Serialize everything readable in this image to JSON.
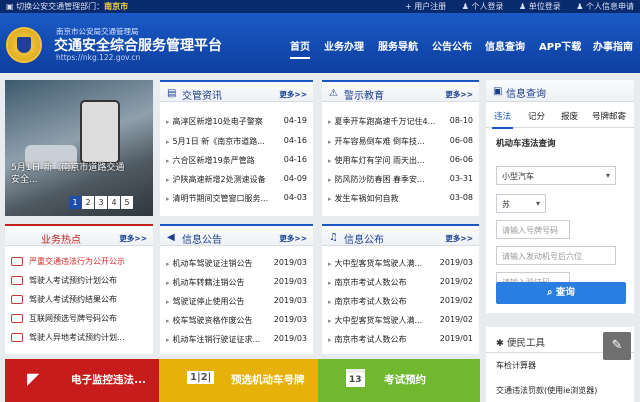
{
  "topbar": {
    "switch_label": "切换公安交通管理部门：",
    "city": "南京市",
    "links": [
      "用户注册",
      "个人登录",
      "单位登录",
      "个人信息申请"
    ]
  },
  "header": {
    "dept": "南京市公安局交通管理局",
    "title": "交通安全综合服务管理平台",
    "url": "https://nkg.122.gov.cn"
  },
  "nav": [
    "首页",
    "业务办理",
    "服务导航",
    "公告公布",
    "信息查询",
    "APP下载",
    "办事指南"
  ],
  "slider": {
    "caption": "5月1日 新《南京市道路交通安全...",
    "pages": [
      "1",
      "2",
      "3",
      "4",
      "5"
    ]
  },
  "news": {
    "title": "交管资讯",
    "more": "更多>>",
    "items": [
      {
        "title": "高淳区新增10处电子警察",
        "date": "04-19"
      },
      {
        "title": "5月1日 新《南京市道路...",
        "date": "04-16"
      },
      {
        "title": "六合区新增19条严管路",
        "date": "04-16"
      },
      {
        "title": "沪陕高速新增2处测速设备",
        "date": "04-09"
      },
      {
        "title": "清明节期间交管窗口服务...",
        "date": "04-03"
      }
    ]
  },
  "warning": {
    "title": "警示教育",
    "more": "更多>>",
    "items": [
      {
        "title": "夏季开车跑高速千万记住4...",
        "date": "08-10"
      },
      {
        "title": "开车容易倒车难 倒车技...",
        "date": "06-08"
      },
      {
        "title": "使用车灯有学问 雨天出...",
        "date": "06-06"
      },
      {
        "title": "防风防沙防春困 春季安...",
        "date": "03-31"
      },
      {
        "title": "发生车祸如何自救",
        "date": "03-08"
      }
    ]
  },
  "hot": {
    "title": "业务热点",
    "more": "更多>>",
    "items": [
      "严重交通违法行为公开公示",
      "驾驶人考试预约计划公布",
      "驾驶人考试预约结果公布",
      "互联网预选号牌号码公布",
      "驾驶人异地考试预约计划..."
    ]
  },
  "notice": {
    "title": "信息公告",
    "more": "更多>>",
    "items": [
      {
        "title": "机动车驾驶证注销公告",
        "date": "2019/03"
      },
      {
        "title": "机动车转籍注销公告",
        "date": "2019/03"
      },
      {
        "title": "驾驶证停止使用公告",
        "date": "2019/03"
      },
      {
        "title": "校车驾驶资格作废公告",
        "date": "2019/03"
      },
      {
        "title": "机动车注销行驶证征求...",
        "date": "2019/03"
      }
    ]
  },
  "publish": {
    "title": "信息公布",
    "more": "更多>>",
    "items": [
      {
        "title": "大中型客货车驾驶人满...",
        "date": "2019/03"
      },
      {
        "title": "南京市考试人数公布",
        "date": "2019/02"
      },
      {
        "title": "南京市考试人数公布",
        "date": "2019/02"
      },
      {
        "title": "大中型客货车驾驶人满...",
        "date": "2019/02"
      },
      {
        "title": "南京市考试人数公布",
        "date": "2019/01"
      }
    ]
  },
  "query": {
    "title": "信息查询",
    "tabs": [
      "违法",
      "记分",
      "报废",
      "号牌邮寄"
    ],
    "subtitle": "机动车违法查询",
    "vehicle_type": "小型汽车",
    "province": "苏",
    "plate_placeholder": "请输入号牌号码",
    "engine_placeholder": "请输入发动机号后六位",
    "captcha_placeholder": "请输入验证码",
    "button": "查询"
  },
  "tools": {
    "title": "便民工具",
    "items": [
      "车检计算器",
      "交通违法罚款(使用ie浏览器)"
    ]
  },
  "bottom": [
    {
      "label": "电子监控违法...",
      "color": "#c81c1c"
    },
    {
      "label": "预选机动车号牌",
      "color": "#e7b10b"
    },
    {
      "label": "考试预约",
      "color": "#6fb82f"
    }
  ],
  "icons": {
    "camera": "camera-icon",
    "plate": "license-plate-icon",
    "calendar": "calendar-icon",
    "calendar_day": "13"
  }
}
